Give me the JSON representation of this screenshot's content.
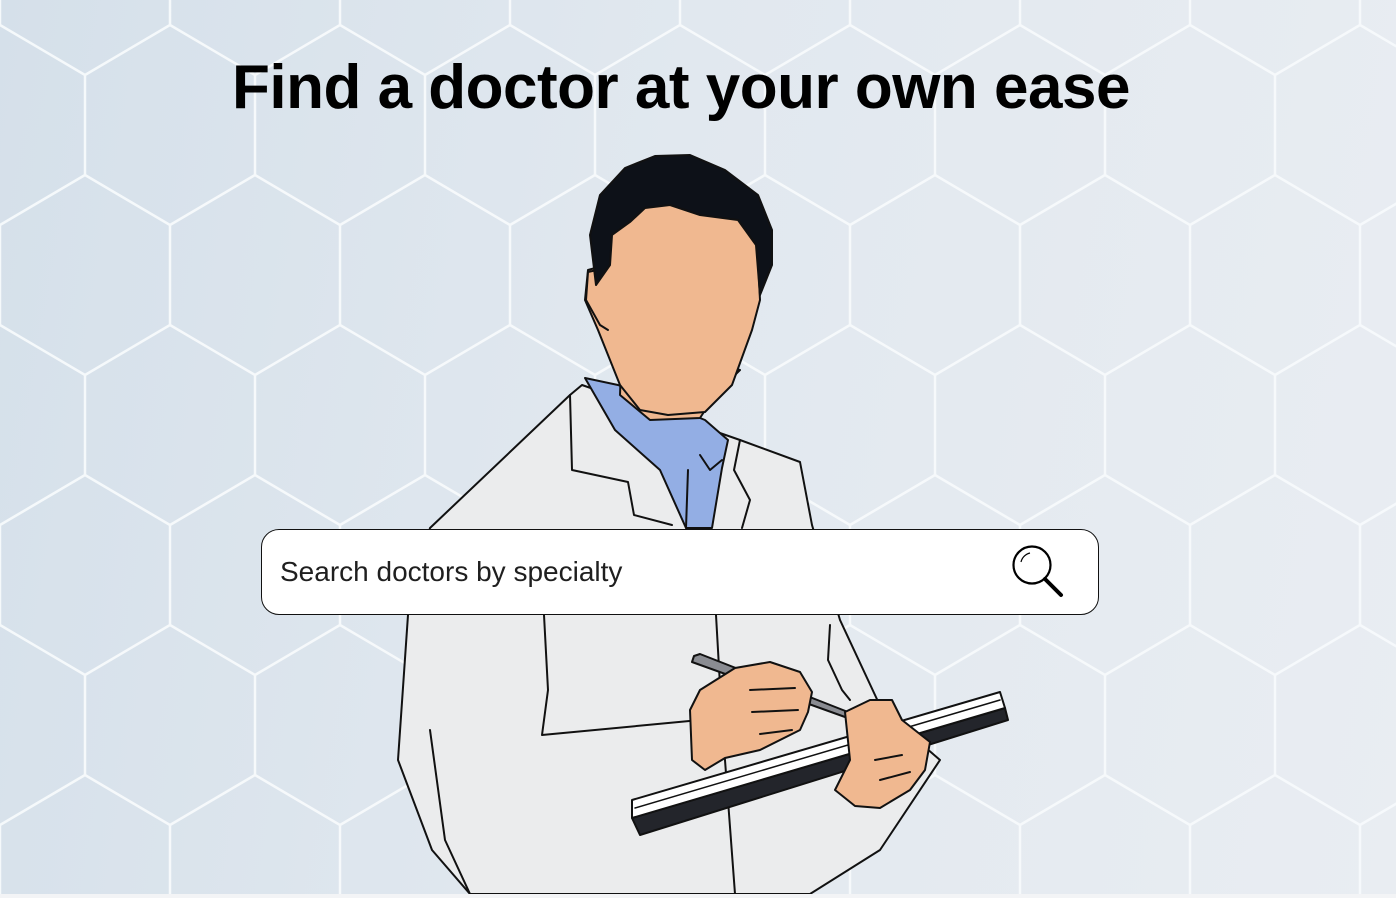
{
  "hero": {
    "title": "Find a doctor at your own ease",
    "illustration": "doctor-writing-on-clipboard",
    "background_pattern": "hexagon-grid"
  },
  "search": {
    "placeholder": "Search doctors by specialty",
    "value": "",
    "button_icon": "search-icon"
  },
  "colors": {
    "background": "#dfe7ee",
    "hex_lines": "#f6f9fc",
    "skin": "#f0b890",
    "hair": "#0d1118",
    "coat": "#ebeced",
    "shirt": "#93aee4",
    "clipboard": "#23252b",
    "text": "#000000"
  }
}
